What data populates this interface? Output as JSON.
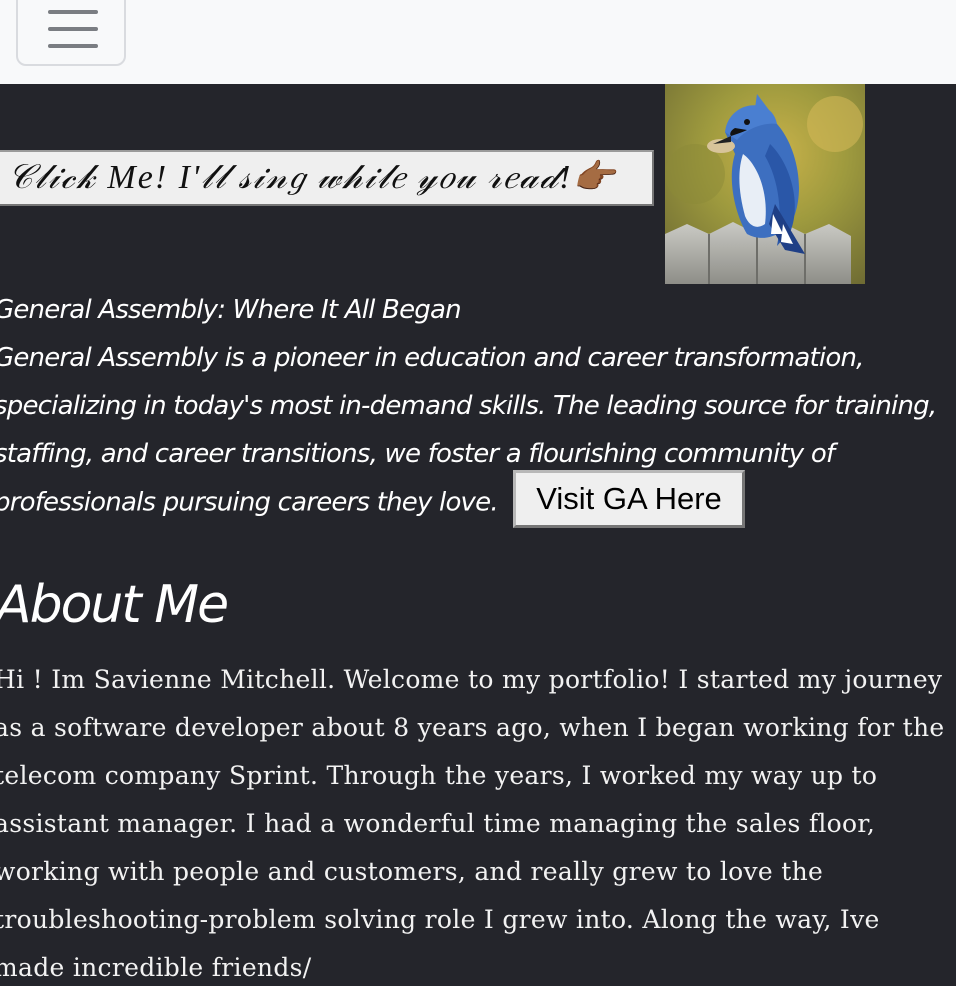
{
  "navbar": {
    "menu_toggle_icon": "hamburger-menu-icon"
  },
  "hero": {
    "sing_button_label": "𝒞𝓁𝒾𝒸𝓀 Me! I'𝓁𝓁 𝓈𝒾𝓃𝑔 𝓌𝒽𝒾𝓁𝑒 𝓎𝑜𝓊 𝓇𝑒𝒶𝒹!👉🏾",
    "bird_image": "blue-jay-bird-image"
  },
  "ga": {
    "title": "General Assembly: Where It All Began",
    "description": "General Assembly is a pioneer in education and career transformation, specializing in today's most in-demand skills. The leading source for training, staffing, and career transitions, we foster a flourishing community of professionals pursuing careers they love.",
    "visit_button_label": "Visit GA Here"
  },
  "about": {
    "heading": "About Me",
    "body": "Hi ! Im Savienne Mitchell. Welcome to my portfolio! I started my journey as a software developer about 8 years ago, when I began working for the telecom company Sprint. Through the years, I worked my way up to assistant manager. I had a wonderful time managing the sales floor, working with people and customers, and really grew to love the troubleshooting-problem solving role I grew into. Along the way, Ive made incredible friends/"
  },
  "colors": {
    "navbar_bg": "#f8f9fa",
    "page_bg": "#24252b",
    "text": "#ffffff",
    "button_bg": "#efefef"
  }
}
